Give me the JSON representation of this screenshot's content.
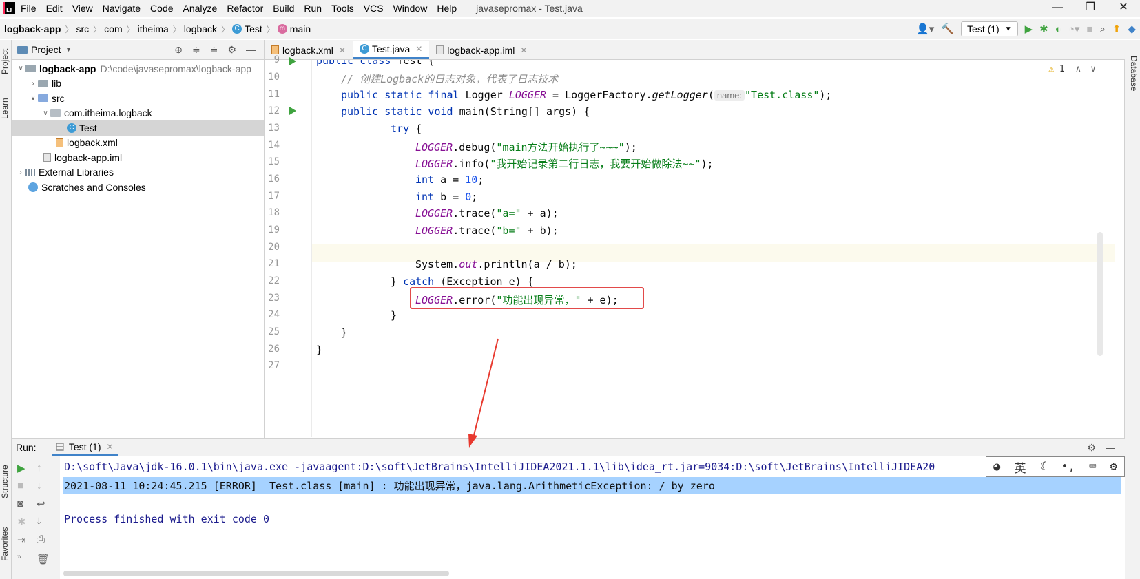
{
  "menu": {
    "items": [
      "File",
      "Edit",
      "View",
      "Navigate",
      "Code",
      "Analyze",
      "Refactor",
      "Build",
      "Run",
      "Tools",
      "VCS",
      "Window",
      "Help"
    ],
    "window_title": "javasepromax - Test.java"
  },
  "breadcrumb": [
    "logback-app",
    "src",
    "com",
    "itheima",
    "logback",
    "Test",
    "main"
  ],
  "toolbar": {
    "run_config": "Test (1)"
  },
  "project": {
    "title": "Project",
    "tree": [
      {
        "label": "logback-app",
        "extra": "D:\\code\\javasepromax\\logback-app"
      },
      {
        "label": "lib"
      },
      {
        "label": "src"
      },
      {
        "label": "com.itheima.logback"
      },
      {
        "label": "Test"
      },
      {
        "label": "logback.xml"
      },
      {
        "label": "logback-app.iml"
      },
      {
        "label": "External Libraries"
      },
      {
        "label": "Scratches and Consoles"
      }
    ]
  },
  "side_labels": {
    "project": "Project",
    "learn": "Learn",
    "structure": "Structure",
    "favorites": "Favorites",
    "database": "Database"
  },
  "tabs": [
    "logback.xml",
    "Test.java",
    "logback-app.iml"
  ],
  "editor": {
    "warnings": "1",
    "line_numbers": [
      "9",
      "10",
      "11",
      "12",
      "13",
      "14",
      "15",
      "16",
      "17",
      "18",
      "19",
      "20",
      "21",
      "22",
      "23",
      "24",
      "25",
      "26",
      "27"
    ],
    "lines": {
      "l9a": "public class",
      "l9b": " Test {",
      "l10": "// 创建Logback的日志对象，代表了日志技术",
      "l11a": "public static final",
      "l11b": " Logger ",
      "l11c": "LOGGER",
      "l11d": " = LoggerFactory.",
      "l11e": "getLogger",
      "l11f": "(",
      "l11hint": "name:",
      "l11g": "\"Test.class\"",
      "l11h": ");",
      "l12a": "public static void",
      "l12b": " main(String[] args) {",
      "l13a": "try",
      "l13b": " {",
      "l14a": "LOGGER",
      "l14b": ".debug(",
      "l14c": "\"main方法开始执行了~~~\"",
      "l14d": ");",
      "l15a": "LOGGER",
      "l15b": ".info(",
      "l15c": "\"我开始记录第二行日志，我要开始做除法~~\"",
      "l15d": ");",
      "l16a": "int",
      "l16b": " a = ",
      "l16c": "10",
      "l16d": ";",
      "l17a": "int",
      "l17b": " b = ",
      "l17c": "0",
      "l17d": ";",
      "l18a": "LOGGER",
      "l18b": ".trace(",
      "l18c": "\"a=\"",
      "l18d": " + a);",
      "l19a": "LOGGER",
      "l19b": ".trace(",
      "l19c": "\"b=\"",
      "l19d": " + b);",
      "l21a": "System.",
      "l21b": "out",
      "l21c": ".println(a / b);",
      "l22a": "} ",
      "l22b": "catch",
      "l22c": " (Exception e) {",
      "l23a": "LOGGER",
      "l23b": ".error(",
      "l23c": "\"功能出现异常，\"",
      "l23d": " + e);",
      "l24": "}",
      "l25": "}",
      "l26": "}"
    }
  },
  "run_panel": {
    "label": "Run:",
    "tab": "Test (1)",
    "console": [
      "D:\\soft\\Java\\jdk-16.0.1\\bin\\java.exe -javaagent:D:\\soft\\JetBrains\\IntelliJIDEA2021.1.1\\lib\\idea_rt.jar=9034:D:\\soft\\JetBrains\\IntelliJIDEA20",
      "2021-08-11 10:24:45.215 [ERROR]  Test.class [main] : 功能出现异常，java.lang.ArithmeticException: / by zero",
      "Process finished with exit code 0"
    ],
    "ime": "英"
  },
  "colors": {
    "accent": "#4083c9",
    "annotation": "#e24a4a",
    "selection": "#a6d2ff"
  }
}
